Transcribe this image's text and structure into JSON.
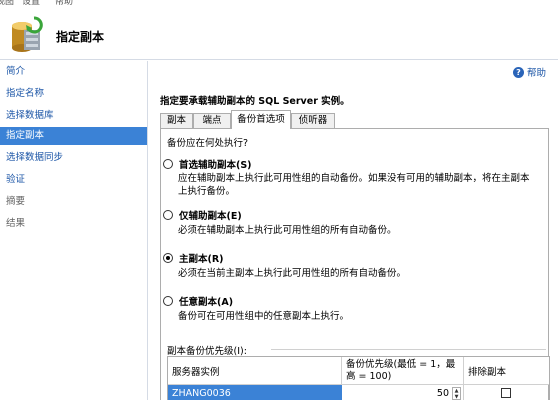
{
  "menu": [
    "视图",
    "设置",
    "帮助"
  ],
  "header": {
    "title": "指定副本",
    "icon": "database-stack-icon"
  },
  "sidebar": {
    "items": [
      {
        "label": "简介",
        "state": "link"
      },
      {
        "label": "指定名称",
        "state": "link"
      },
      {
        "label": "选择数据库",
        "state": "link"
      },
      {
        "label": "指定副本",
        "state": "active"
      },
      {
        "label": "选择数据同步",
        "state": "link"
      },
      {
        "label": "验证",
        "state": "link"
      },
      {
        "label": "摘要",
        "state": "disabled"
      },
      {
        "label": "结果",
        "state": "disabled"
      }
    ]
  },
  "main": {
    "help_label": "帮助",
    "instruction": "指定要承载辅助副本的 SQL Server 实例。",
    "tabs": [
      {
        "label": "副本",
        "active": false
      },
      {
        "label": "端点",
        "active": false
      },
      {
        "label": "备份首选项",
        "active": true
      },
      {
        "label": "侦听器",
        "active": false
      }
    ],
    "backup": {
      "question": "备份应在何处执行?",
      "options": [
        {
          "label": "首选辅助副本(S)",
          "desc": "应在辅助副本上执行此可用性组的自动备份。如果没有可用的辅助副本，将在主副本上执行备份。",
          "checked": false
        },
        {
          "label": "仅辅助副本(E)",
          "desc": "必须在辅助副本上执行此可用性组的所有自动备份。",
          "checked": false
        },
        {
          "label": "主副本(R)",
          "desc": "必须在当前主副本上执行此可用性组的所有自动备份。",
          "checked": true
        },
        {
          "label": "任意副本(A)",
          "desc": "备份可在可用性组中的任意副本上执行。",
          "checked": false
        }
      ],
      "priority_group_label": "副本备份优先级(I):",
      "table": {
        "headers": [
          "服务器实例",
          "备份优先级(最低 = 1，最高 = 100)",
          "排除副本"
        ],
        "rows": [
          {
            "server": "ZHANG0036",
            "priority": "50",
            "exclude": false
          }
        ]
      }
    }
  },
  "colors": {
    "accent": "#3b82d6",
    "link": "#1a54a6"
  }
}
